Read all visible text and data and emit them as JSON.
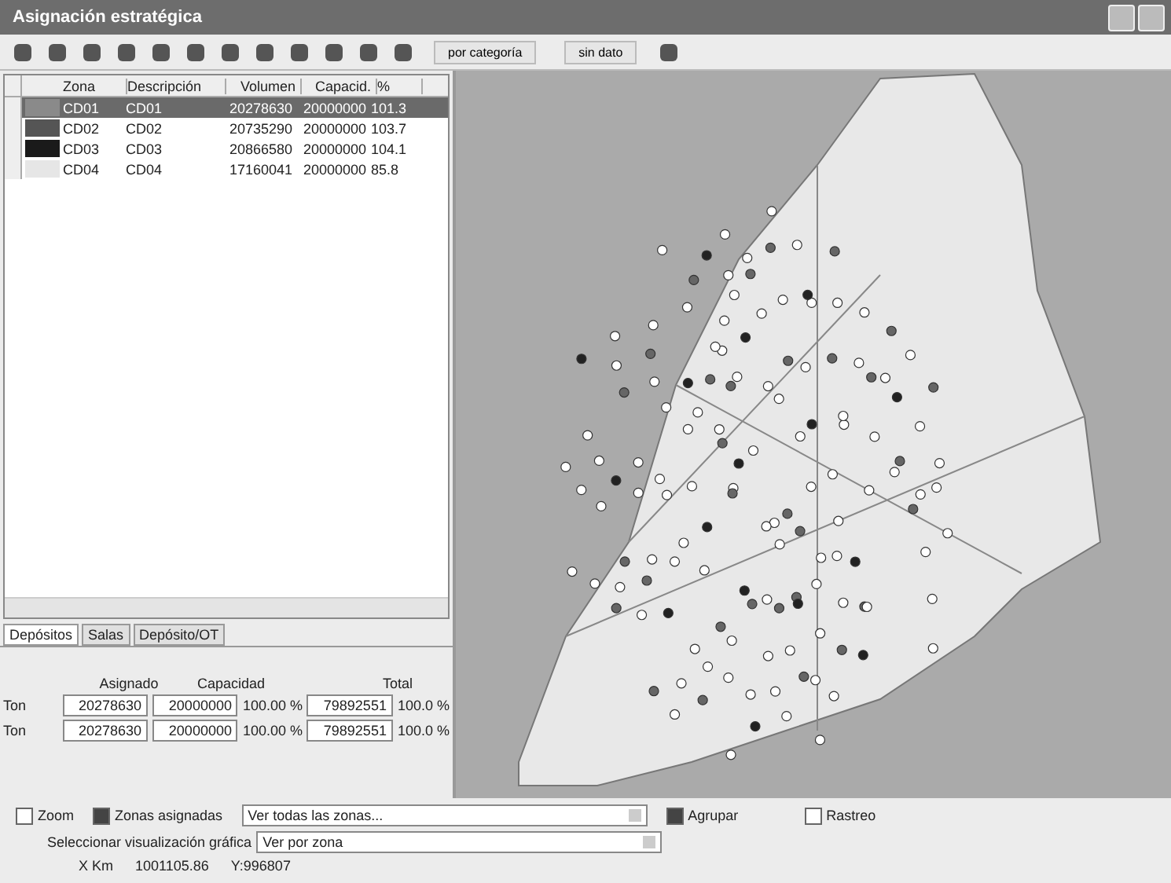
{
  "window": {
    "title": "Asignación estratégica"
  },
  "toolbar": {
    "category_button": "por categoría",
    "nodata_button": "sin dato"
  },
  "table": {
    "columns": [
      "Zona",
      "Descripción",
      "Volumen",
      "Capacid.",
      "%"
    ],
    "rows": [
      {
        "color": "#8a8a8a",
        "cells": [
          "CD01",
          "CD01",
          "20278630",
          "20000000",
          "101.3"
        ],
        "selected": true
      },
      {
        "color": "#555555",
        "cells": [
          "CD02",
          "CD02",
          "20735290",
          "20000000",
          "103.7"
        ],
        "selected": false
      },
      {
        "color": "#1a1a1a",
        "cells": [
          "CD03",
          "CD03",
          "20866580",
          "20000000",
          "104.1"
        ],
        "selected": false
      },
      {
        "color": "#e6e6e6",
        "cells": [
          "CD04",
          "CD04",
          "17160041",
          "20000000",
          "85.8"
        ],
        "selected": false
      }
    ]
  },
  "tabs": [
    {
      "label": "Depósitos",
      "selected": true
    },
    {
      "label": "Salas",
      "selected": false
    },
    {
      "label": "Depósito/OT",
      "selected": false
    }
  ],
  "summary": {
    "headers": [
      "Asignado",
      "Capacidad",
      "Total"
    ],
    "rows": [
      {
        "unit": "Ton",
        "assigned": "20278630",
        "capacity": "20000000",
        "pct": "100.00 %",
        "total": "79892551",
        "total_pct": "100.0 %"
      },
      {
        "unit": "Ton",
        "assigned": "20278630",
        "capacity": "20000000",
        "pct": "100.00 %",
        "total": "79892551",
        "total_pct": "100.0 %"
      }
    ]
  },
  "options": {
    "zoom": {
      "label": "Zoom",
      "checked": false
    },
    "assigned": {
      "label": "Zonas asignadas",
      "checked": true,
      "value": "Ver todas las zonas..."
    },
    "group": {
      "label": "Agrupar",
      "checked": true
    },
    "trace": {
      "label": "Rastreo",
      "checked": false
    },
    "view": {
      "label": "Seleccionar visualización gráfica",
      "value": "Ver por zona"
    }
  },
  "status": {
    "x_label": "X Km",
    "x_value": "1001105.86",
    "y_value": "Y:996807"
  }
}
